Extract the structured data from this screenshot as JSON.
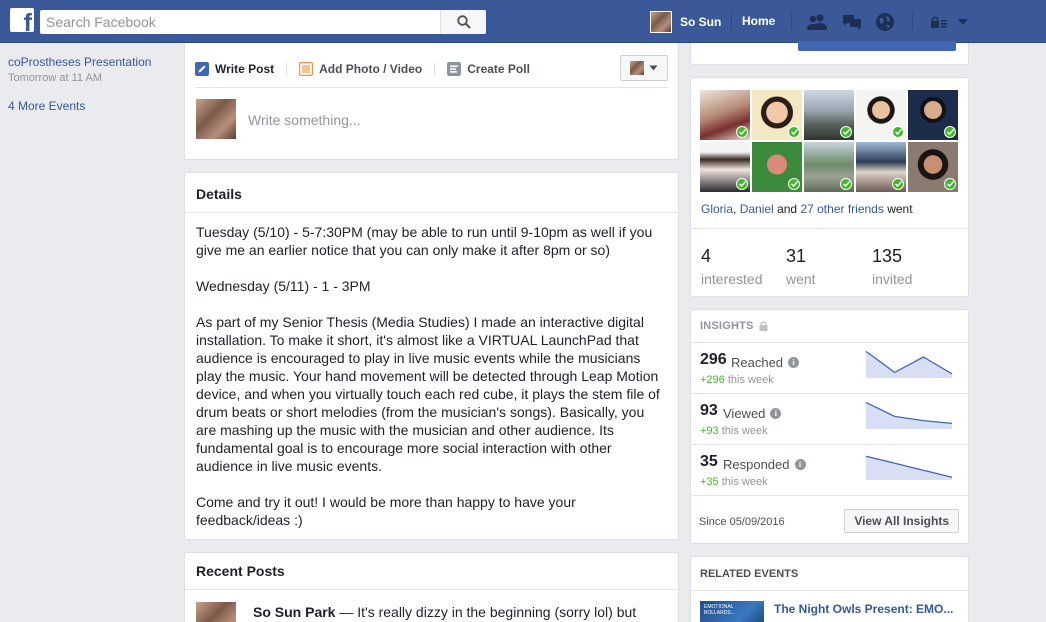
{
  "topbar": {
    "logo_letter": "f",
    "search_placeholder": "Search Facebook",
    "profile_name": "So Sun",
    "home_label": "Home"
  },
  "left": {
    "event_title": "coProstheses Presentation",
    "event_time": "Tomorrow at 11 AM",
    "more_events": "4 More Events"
  },
  "composer": {
    "tabs": [
      "Write Post",
      "Add Photo / Video",
      "Create Poll"
    ],
    "placeholder": "Write something..."
  },
  "details": {
    "title": "Details",
    "paragraphs": [
      "Tuesday (5/10) - 5-7:30PM (may be able to run until 9-10pm as well if you give me an earlier notice that you can only make it after 8pm or so)",
      "Wednesday (5/11) - 1 - 3PM",
      "As part of my Senior Thesis (Media Studies) I made an interactive digital installation. To make it short, it's almost like a VIRTUAL LaunchPad that audience is encouraged to play in live music events while the musicians play the music. Your hand movement will be detected through Leap Motion device, and when you virtually touch each red cube, it plays the stem file of drum beats or short melodies (from the musician's songs). Basically, you are mashing up the music with the musician and other audience. Its fundamental goal is to encourage more social interaction with other audience in live music events.",
      "Come and try it out! I would be more than happy to have your feedback/ideas :)"
    ]
  },
  "recent": {
    "title": "Recent Posts",
    "author": "So Sun Park",
    "snippet": "— It's really dizzy in the beginning (sorry lol) but"
  },
  "friends": {
    "name1": "Gloria",
    "name2": "Daniel",
    "and1": ",",
    "and2": "and",
    "others": "27 other friends",
    "went_suffix": "went",
    "stats": [
      {
        "num": "4",
        "label": "interested"
      },
      {
        "num": "31",
        "label": "went"
      },
      {
        "num": "135",
        "label": "invited"
      }
    ]
  },
  "insights": {
    "title": "INSIGHTS",
    "rows": [
      {
        "num": "296",
        "label": "Reached",
        "week_value": "+296",
        "week_suffix": "this week",
        "trend": [
          0.95,
          0.2,
          0.75,
          0.15
        ]
      },
      {
        "num": "93",
        "label": "Viewed",
        "week_value": "+93",
        "week_suffix": "this week",
        "trend": [
          0.95,
          0.45,
          0.3,
          0.2
        ]
      },
      {
        "num": "35",
        "label": "Responded",
        "week_value": "+35",
        "week_suffix": "this week",
        "trend": [
          0.85,
          0.6,
          0.35,
          0.1
        ]
      }
    ],
    "since": "Since 05/09/2016",
    "view_all": "View All Insights"
  },
  "related": {
    "title": "RELATED EVENTS",
    "event_title": "The Night Owls Present: EMO...",
    "thumb_text": "EMOTIONAL BOLLARDS..."
  },
  "colors": {
    "brand": "#3b5998",
    "link": "#365899",
    "green": "#42b72a",
    "chart_fill": "#d8dff5",
    "chart_line": "#4267b2"
  }
}
